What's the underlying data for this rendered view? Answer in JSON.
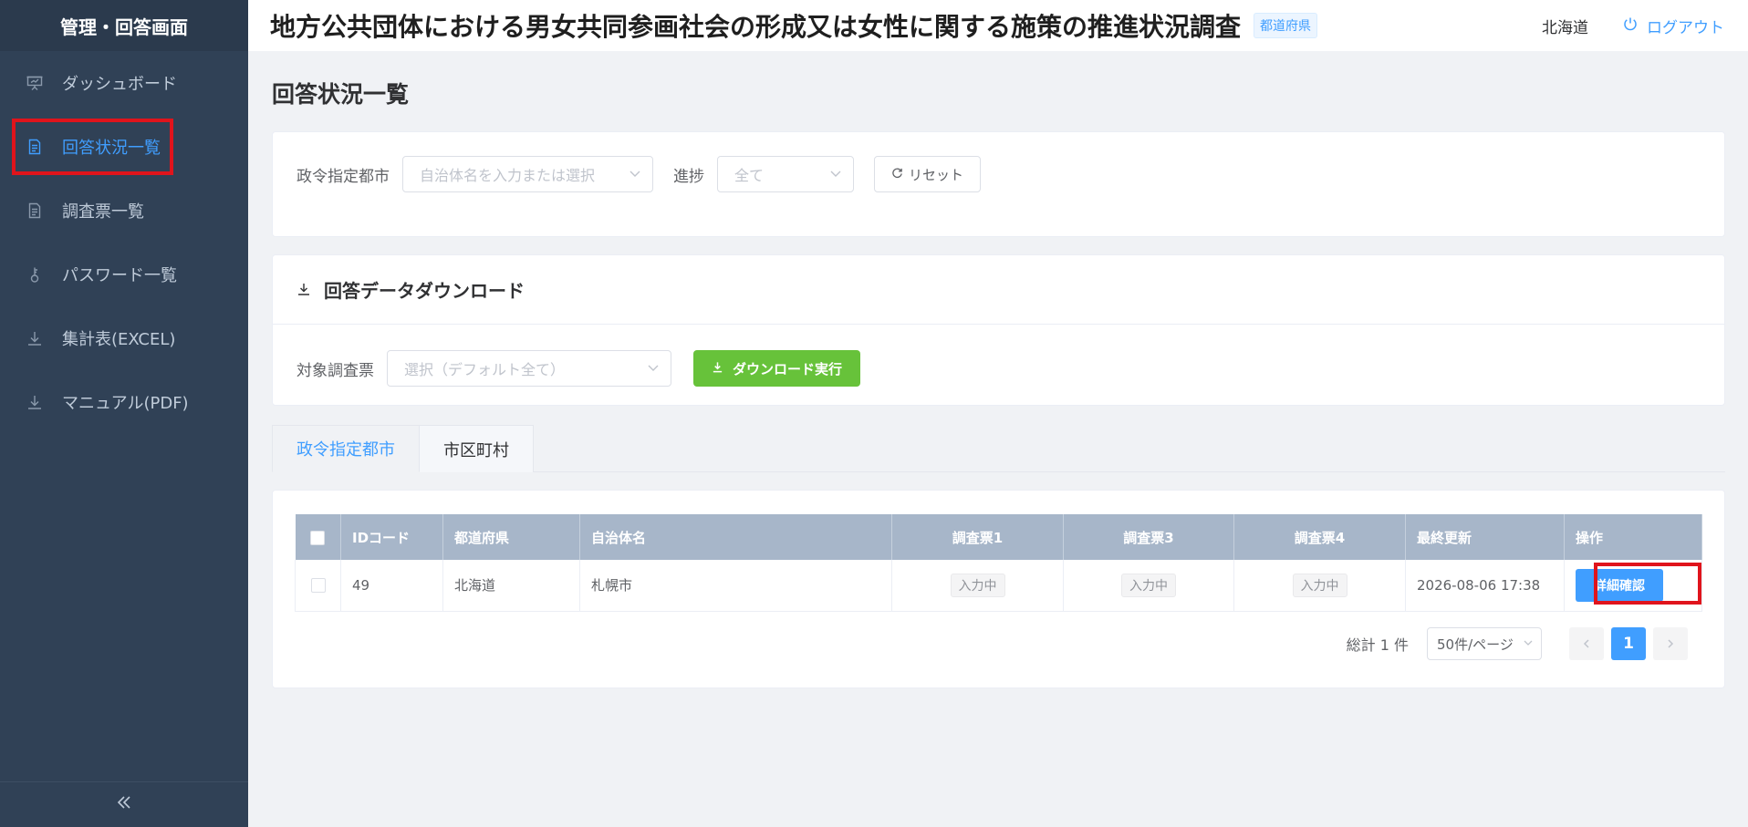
{
  "sidebar": {
    "title": "管理・回答画面",
    "items": [
      {
        "label": "ダッシュボード",
        "icon": "presentation-icon"
      },
      {
        "label": "回答状況一覧",
        "icon": "document-icon",
        "active": true
      },
      {
        "label": "調査票一覧",
        "icon": "document-icon"
      },
      {
        "label": "パスワード一覧",
        "icon": "key-icon"
      },
      {
        "label": "集計表(EXCEL)",
        "icon": "download-icon"
      },
      {
        "label": "マニュアル(PDF)",
        "icon": "download-icon"
      }
    ],
    "collapse_icon": "double-chevron-left-icon"
  },
  "header": {
    "title": "地方公共団体における男女共同参画社会の形成又は女性に関する施策の推進状況調査",
    "badge": "都道府県",
    "user": "北海道",
    "logout": "ログアウト"
  },
  "main": {
    "page_title": "回答状況一覧",
    "filter": {
      "city_label": "政令指定都市",
      "city_placeholder": "自治体名を入力または選択",
      "progress_label": "進捗",
      "progress_value": "全て",
      "reset_label": "リセット"
    },
    "download": {
      "title": "回答データダウンロード",
      "target_label": "対象調査票",
      "target_placeholder": "選択（デフォルト全て）",
      "button_label": "ダウンロード実行"
    },
    "tabs": [
      {
        "label": "政令指定都市",
        "active": true
      },
      {
        "label": "市区町村"
      }
    ],
    "table": {
      "headers": [
        "IDコード",
        "都道府県",
        "自治体名",
        "調査票1",
        "調査票3",
        "調査票4",
        "最終更新",
        "操作"
      ],
      "rows": [
        {
          "id": "49",
          "prefecture": "北海道",
          "municipality": "札幌市",
          "survey1": "入力中",
          "survey3": "入力中",
          "survey4": "入力中",
          "updated": "2026-08-06 17:38",
          "action": "詳細確認"
        }
      ]
    },
    "pagination": {
      "total": "総計 1 件",
      "page_size": "50件/ページ",
      "current_page": "1"
    }
  },
  "colors": {
    "sidebar_bg": "#304156",
    "accent": "#409eff",
    "success": "#67c23a",
    "table_header": "#a7b6c9",
    "highlight": "#e0141c"
  }
}
